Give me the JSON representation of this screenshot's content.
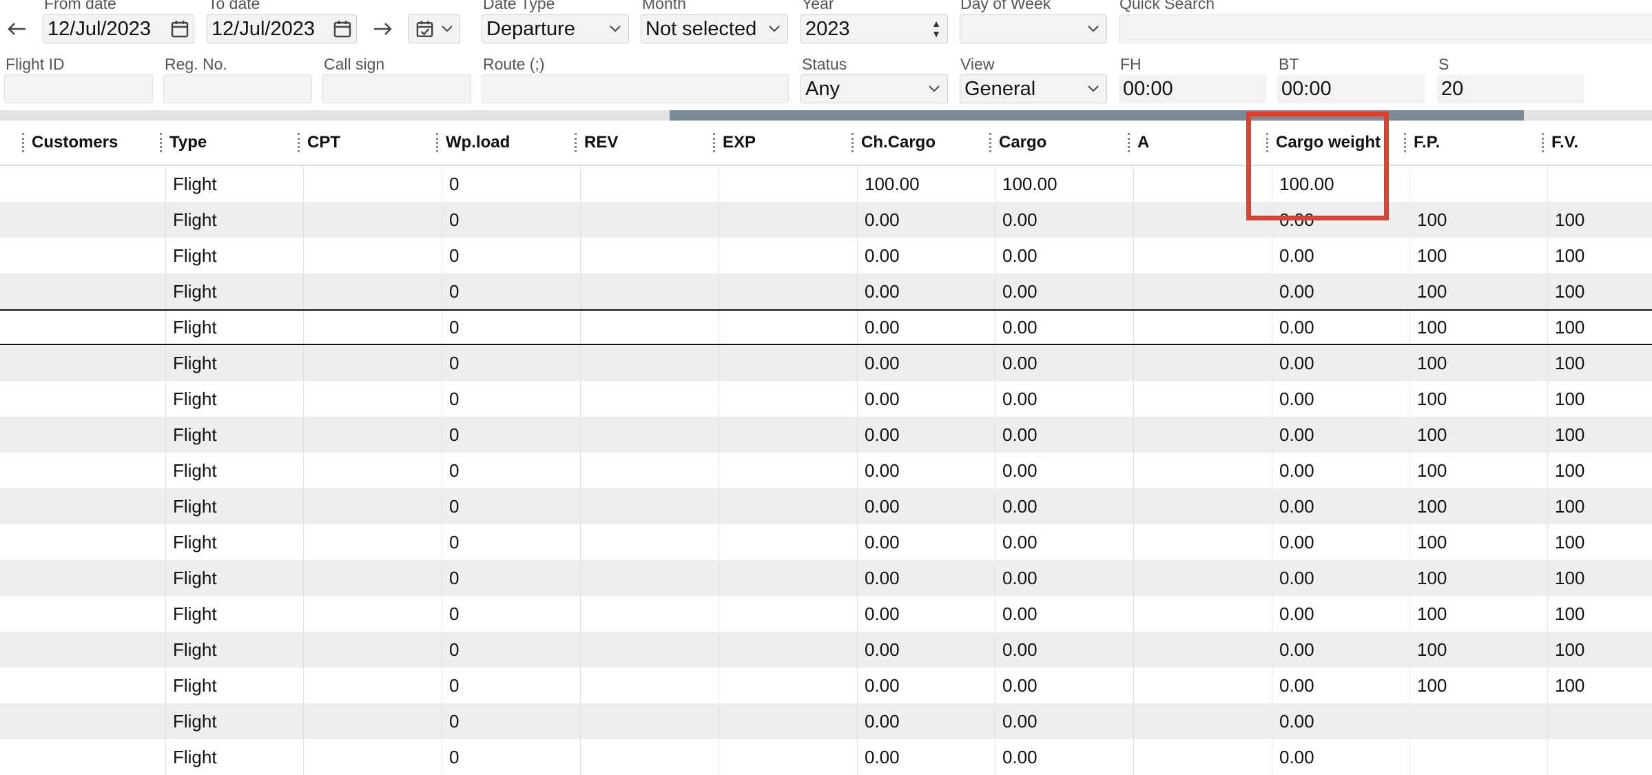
{
  "filters": {
    "from_date": {
      "label": "From date",
      "value": "12/Jul/2023"
    },
    "to_date": {
      "label": "To date",
      "value": "12/Jul/2023"
    },
    "date_type": {
      "label": "Date Type",
      "value": "Departure"
    },
    "month": {
      "label": "Month",
      "value": "Not selected"
    },
    "year": {
      "label": "Year",
      "value": "2023"
    },
    "day_of_week": {
      "label": "Day of Week",
      "value": ""
    },
    "quick_search": {
      "label": "Quick Search",
      "value": ""
    },
    "flight_id": {
      "label": "Flight ID",
      "value": ""
    },
    "reg_no": {
      "label": "Reg. No.",
      "value": ""
    },
    "call_sign": {
      "label": "Call sign",
      "value": ""
    },
    "route": {
      "label": "Route (;)",
      "value": ""
    },
    "status": {
      "label": "Status",
      "value": "Any"
    },
    "view": {
      "label": "View",
      "value": "General"
    },
    "fh": {
      "label": "FH",
      "value": "00:00"
    },
    "bt": {
      "label": "BT",
      "value": "00:00"
    },
    "s": {
      "label": "S",
      "value": "20"
    }
  },
  "icons": {
    "prev": "arrow-left-icon",
    "next": "arrow-right-icon",
    "calendar": "calendar-icon",
    "calendar_check": "calendar-check-icon",
    "dropdown": "chevron-down-icon"
  },
  "grid": {
    "columns": [
      "Customers",
      "Type",
      "CPT",
      "Wp.load",
      "REV",
      "EXP",
      "Ch.Cargo",
      "Cargo",
      "A",
      "Cargo weight",
      "F.P.",
      "F.V."
    ],
    "rows": [
      [
        "",
        "Flight",
        "",
        "0",
        "",
        "",
        "100.00",
        "100.00",
        "",
        "100.00",
        "",
        ""
      ],
      [
        "",
        "Flight",
        "",
        "0",
        "",
        "",
        "0.00",
        "0.00",
        "",
        "0.00",
        "100",
        "100"
      ],
      [
        "",
        "Flight",
        "",
        "0",
        "",
        "",
        "0.00",
        "0.00",
        "",
        "0.00",
        "100",
        "100"
      ],
      [
        "",
        "Flight",
        "",
        "0",
        "",
        "",
        "0.00",
        "0.00",
        "",
        "0.00",
        "100",
        "100"
      ],
      [
        "",
        "Flight",
        "",
        "0",
        "",
        "",
        "0.00",
        "0.00",
        "",
        "0.00",
        "100",
        "100"
      ],
      [
        "",
        "Flight",
        "",
        "0",
        "",
        "",
        "0.00",
        "0.00",
        "",
        "0.00",
        "100",
        "100"
      ],
      [
        "",
        "Flight",
        "",
        "0",
        "",
        "",
        "0.00",
        "0.00",
        "",
        "0.00",
        "100",
        "100"
      ],
      [
        "",
        "Flight",
        "",
        "0",
        "",
        "",
        "0.00",
        "0.00",
        "",
        "0.00",
        "100",
        "100"
      ],
      [
        "",
        "Flight",
        "",
        "0",
        "",
        "",
        "0.00",
        "0.00",
        "",
        "0.00",
        "100",
        "100"
      ],
      [
        "",
        "Flight",
        "",
        "0",
        "",
        "",
        "0.00",
        "0.00",
        "",
        "0.00",
        "100",
        "100"
      ],
      [
        "",
        "Flight",
        "",
        "0",
        "",
        "",
        "0.00",
        "0.00",
        "",
        "0.00",
        "100",
        "100"
      ],
      [
        "",
        "Flight",
        "",
        "0",
        "",
        "",
        "0.00",
        "0.00",
        "",
        "0.00",
        "100",
        "100"
      ],
      [
        "",
        "Flight",
        "",
        "0",
        "",
        "",
        "0.00",
        "0.00",
        "",
        "0.00",
        "100",
        "100"
      ],
      [
        "",
        "Flight",
        "",
        "0",
        "",
        "",
        "0.00",
        "0.00",
        "",
        "0.00",
        "100",
        "100"
      ],
      [
        "",
        "Flight",
        "",
        "0",
        "",
        "",
        "0.00",
        "0.00",
        "",
        "0.00",
        "100",
        "100"
      ],
      [
        "",
        "Flight",
        "",
        "0",
        "",
        "",
        "0.00",
        "0.00",
        "",
        "0.00",
        "",
        ""
      ],
      [
        "",
        "Flight",
        "",
        "0",
        "",
        "",
        "0.00",
        "0.00",
        "",
        "0.00",
        "",
        ""
      ]
    ]
  },
  "colors": {
    "highlight": "#e2402c",
    "scroll_thumb": "#7d8b96",
    "row_alt": "#eeeef0"
  }
}
